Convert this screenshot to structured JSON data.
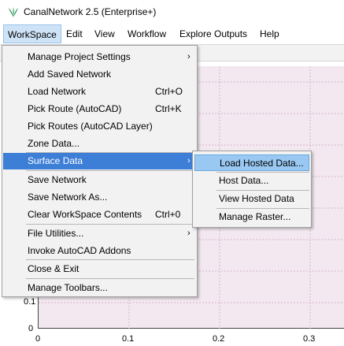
{
  "app": {
    "title": "CanalNetwork 2.5  (Enterprise+)",
    "icon": "canal-leaf-icon"
  },
  "menubar": {
    "items": [
      "WorkSpace",
      "Edit",
      "View",
      "Workflow",
      "Explore Outputs",
      "Help"
    ]
  },
  "workspace_menu": {
    "items": [
      {
        "label": "Manage Project Settings",
        "shortcut": "",
        "submenu": true
      },
      {
        "label": "Add Saved Network",
        "shortcut": ""
      },
      {
        "label": "Load Network",
        "shortcut": "Ctrl+O"
      },
      {
        "label": "Pick Route (AutoCAD)",
        "shortcut": "Ctrl+K"
      },
      {
        "label": "Pick Routes (AutoCAD Layer)",
        "shortcut": ""
      },
      {
        "label": "Zone Data...",
        "shortcut": ""
      },
      {
        "label": "Surface Data",
        "shortcut": "",
        "submenu": true,
        "highlighted": true
      },
      {
        "label": "Save Network",
        "shortcut": ""
      },
      {
        "label": "Save Network As...",
        "shortcut": ""
      },
      {
        "label": "Clear WorkSpace Contents",
        "shortcut": "Ctrl+0"
      },
      {
        "label": "File Utilities...",
        "shortcut": "",
        "submenu": true
      },
      {
        "label": "Invoke AutoCAD Addons",
        "shortcut": ""
      },
      {
        "label": "Close & Exit",
        "shortcut": ""
      },
      {
        "label": "Manage Toolbars...",
        "shortcut": ""
      }
    ],
    "arrow_glyph": "›"
  },
  "surface_submenu": {
    "items": [
      {
        "label": "Load Hosted Data...",
        "highlighted": true
      },
      {
        "label": "Host Data..."
      },
      {
        "label": "View Hosted Data"
      },
      {
        "label": "Manage Raster..."
      }
    ]
  },
  "plot": {
    "y_ticks": [
      "0.1",
      "0"
    ],
    "x_ticks": [
      "0",
      "0.1",
      "0.2",
      "0.3"
    ],
    "background": "#f3e8f0"
  },
  "colors": {
    "highlight": "#3d7ed6",
    "submenu_highlight": "#99c9f2",
    "menu_bg": "#f2f2f2"
  }
}
